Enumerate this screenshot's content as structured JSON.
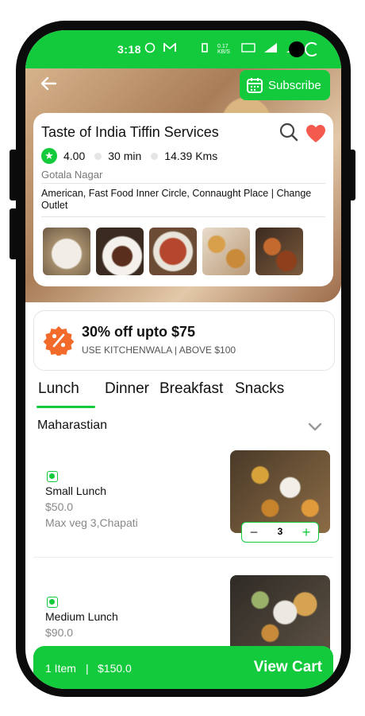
{
  "status_bar": {
    "time": "3:18",
    "signal_text": "0.17 KB/S",
    "network": "4G",
    "battery": "5"
  },
  "header": {
    "subscribe_label": "Subscribe"
  },
  "restaurant": {
    "name": "Taste of India Tiffin Services",
    "rating": "4.00",
    "time": "30 min",
    "distance": "14.39 Kms",
    "area": "Gotala Nagar",
    "cuisine": "American, Fast Food Inner Circle, Connaught Place | Change Outlet"
  },
  "offer": {
    "title": "30% off upto $75",
    "subtitle": "USE KITCHENWALA | ABOVE $100"
  },
  "tabs": [
    "Lunch",
    "Dinner",
    "Breakfast",
    "Snacks"
  ],
  "section": {
    "title": "Maharastian"
  },
  "items": [
    {
      "name": "Small Lunch",
      "price": "$50.0",
      "desc": "Max veg 3,Chapati",
      "qty": "3"
    },
    {
      "name": "Medium Lunch",
      "price": "$90.0"
    }
  ],
  "cart": {
    "count": "1 Item",
    "separator": "|",
    "total": "$150.0",
    "cta": "View Cart"
  },
  "colors": {
    "accent": "#13c93c",
    "heart": "#f55a4e",
    "offer": "#f26b2a"
  }
}
